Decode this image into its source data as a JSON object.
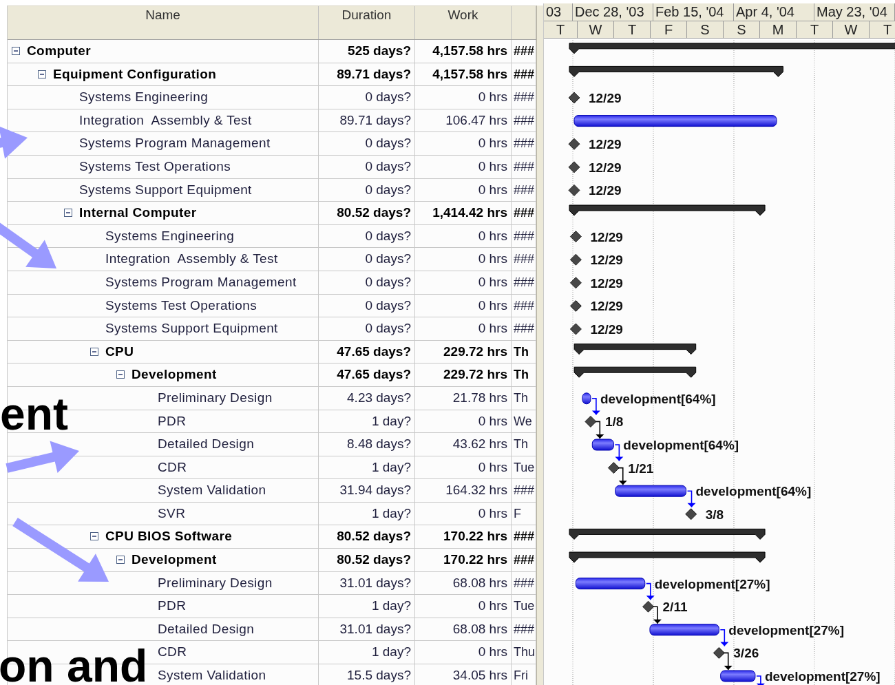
{
  "table": {
    "columns": [
      {
        "label": "Name"
      },
      {
        "label": "Duration"
      },
      {
        "label": "Work"
      }
    ],
    "tasks": [
      {
        "name": "Computer",
        "duration": "525 days?",
        "work": "4,157.58 hrs",
        "column_4": "###",
        "expanded": true,
        "bar": {
          "kind": "summary"
        },
        "children": [
          {
            "name": "Equipment Configuration",
            "duration": "89.71 days?",
            "work": "4,157.58 hrs",
            "column_4": "###",
            "expanded": true,
            "bar": {
              "kind": "summary"
            },
            "children": [
              {
                "name": "Systems Engineering",
                "duration": "0 days?",
                "work": "0 hrs",
                "column_4": "###",
                "bar": {
                  "kind": "milestone",
                  "label": "12/29"
                }
              },
              {
                "name": "Integration  Assembly & Test",
                "duration": "89.71 days?",
                "work": "106.47 hrs",
                "column_4": "###",
                "bar": {
                  "kind": "task"
                }
              },
              {
                "name": "Systems Program Management",
                "duration": "0 days?",
                "work": "0 hrs",
                "column_4": "###",
                "bar": {
                  "kind": "milestone",
                  "label": "12/29"
                }
              },
              {
                "name": "Systems Test Operations",
                "duration": "0 days?",
                "work": "0 hrs",
                "column_4": "###",
                "bar": {
                  "kind": "milestone",
                  "label": "12/29"
                }
              },
              {
                "name": "Systems Support Equipment",
                "duration": "0 days?",
                "work": "0 hrs",
                "column_4": "###",
                "bar": {
                  "kind": "milestone",
                  "label": "12/29"
                }
              },
              {
                "name": "Internal Computer",
                "duration": "80.52 days?",
                "work": "1,414.42 hrs",
                "column_4": "###",
                "expanded": true,
                "bar": {
                  "kind": "summary"
                },
                "children": [
                  {
                    "name": "Systems Engineering",
                    "duration": "0 days?",
                    "work": "0 hrs",
                    "column_4": "###",
                    "bar": {
                      "kind": "milestone",
                      "label": "12/29"
                    }
                  },
                  {
                    "name": "Integration  Assembly & Test",
                    "duration": "0 days?",
                    "work": "0 hrs",
                    "column_4": "###",
                    "bar": {
                      "kind": "milestone",
                      "label": "12/29"
                    }
                  },
                  {
                    "name": "Systems Program Management",
                    "duration": "0 days?",
                    "work": "0 hrs",
                    "column_4": "###",
                    "bar": {
                      "kind": "milestone",
                      "label": "12/29"
                    }
                  },
                  {
                    "name": "Systems Test Operations",
                    "duration": "0 days?",
                    "work": "0 hrs",
                    "column_4": "###",
                    "bar": {
                      "kind": "milestone",
                      "label": "12/29"
                    }
                  },
                  {
                    "name": "Systems Support Equipment",
                    "duration": "0 days?",
                    "work": "0 hrs",
                    "column_4": "###",
                    "bar": {
                      "kind": "milestone",
                      "label": "12/29"
                    }
                  },
                  {
                    "name": "CPU",
                    "duration": "47.65 days?",
                    "work": "229.72 hrs",
                    "column_4": "Th",
                    "expanded": true,
                    "bar": {
                      "kind": "summary"
                    },
                    "children": [
                      {
                        "name": "Development",
                        "duration": "47.65 days?",
                        "work": "229.72 hrs",
                        "column_4": "Th",
                        "expanded": true,
                        "bar": {
                          "kind": "summary"
                        },
                        "children": [
                          {
                            "name": "Preliminary Design",
                            "duration": "4.23 days?",
                            "work": "21.78 hrs",
                            "column_4": "Th",
                            "bar": {
                              "kind": "task",
                              "label": "development[64%]",
                              "linked": true
                            }
                          },
                          {
                            "name": "PDR",
                            "duration": "1 day?",
                            "work": "0 hrs",
                            "column_4": "We",
                            "bar": {
                              "kind": "milestone",
                              "label": "1/8",
                              "linked": true
                            }
                          },
                          {
                            "name": "Detailed Design",
                            "duration": "8.48 days?",
                            "work": "43.62 hrs",
                            "column_4": "Th",
                            "bar": {
                              "kind": "task",
                              "label": "development[64%]",
                              "linked": true
                            }
                          },
                          {
                            "name": "CDR",
                            "duration": "1 day?",
                            "work": "0 hrs",
                            "column_4": "Tue",
                            "bar": {
                              "kind": "milestone",
                              "label": "1/21",
                              "linked": true
                            }
                          },
                          {
                            "name": "System Validation",
                            "duration": "31.94 days?",
                            "work": "164.32 hrs",
                            "column_4": "###",
                            "bar": {
                              "kind": "task",
                              "label": "development[64%]",
                              "linked": true
                            }
                          },
                          {
                            "name": "SVR",
                            "duration": "1 day?",
                            "work": "0 hrs",
                            "column_4": "F",
                            "bar": {
                              "kind": "milestone",
                              "label": "3/8"
                            }
                          }
                        ]
                      }
                    ]
                  },
                  {
                    "name": "CPU BIOS Software",
                    "duration": "80.52 days?",
                    "work": "170.22 hrs",
                    "column_4": "###",
                    "expanded": true,
                    "bar": {
                      "kind": "summary"
                    },
                    "children": [
                      {
                        "name": "Development",
                        "duration": "80.52 days?",
                        "work": "170.22 hrs",
                        "column_4": "###",
                        "expanded": true,
                        "bar": {
                          "kind": "summary"
                        },
                        "children": [
                          {
                            "name": "Preliminary Design",
                            "duration": "31.01 days?",
                            "work": "68.08 hrs",
                            "column_4": "###",
                            "bar": {
                              "kind": "task",
                              "label": "development[27%]",
                              "linked": true
                            }
                          },
                          {
                            "name": "PDR",
                            "duration": "1 day?",
                            "work": "0 hrs",
                            "column_4": "Tue",
                            "bar": {
                              "kind": "milestone",
                              "label": "2/11",
                              "linked": true
                            }
                          },
                          {
                            "name": "Detailed Design",
                            "duration": "31.01 days?",
                            "work": "68.08 hrs",
                            "column_4": "###",
                            "bar": {
                              "kind": "task",
                              "label": "development[27%]",
                              "linked": true
                            }
                          },
                          {
                            "name": "CDR",
                            "duration": "1 day?",
                            "work": "0 hrs",
                            "column_4": "Thu",
                            "bar": {
                              "kind": "milestone",
                              "label": "3/26",
                              "linked": true
                            }
                          },
                          {
                            "name": "System Validation",
                            "duration": "15.5 days?",
                            "work": "34.05 hrs",
                            "column_4": "Fri",
                            "bar": {
                              "kind": "task",
                              "label": "development[27%]",
                              "linked": true
                            }
                          }
                        ]
                      }
                    ]
                  }
                ]
              }
            ]
          }
        ]
      }
    ]
  },
  "timescale": {
    "major": [
      "03",
      "Dec 28, '03",
      "Feb 15, '04",
      "Apr 4, '04",
      "May 23, '04"
    ],
    "minor": [
      "T",
      "W",
      "T",
      "F",
      "S",
      "S",
      "M",
      "T",
      "W",
      "T"
    ]
  },
  "slide_overlay": {
    "texts": [
      "ent",
      "on and"
    ]
  }
}
